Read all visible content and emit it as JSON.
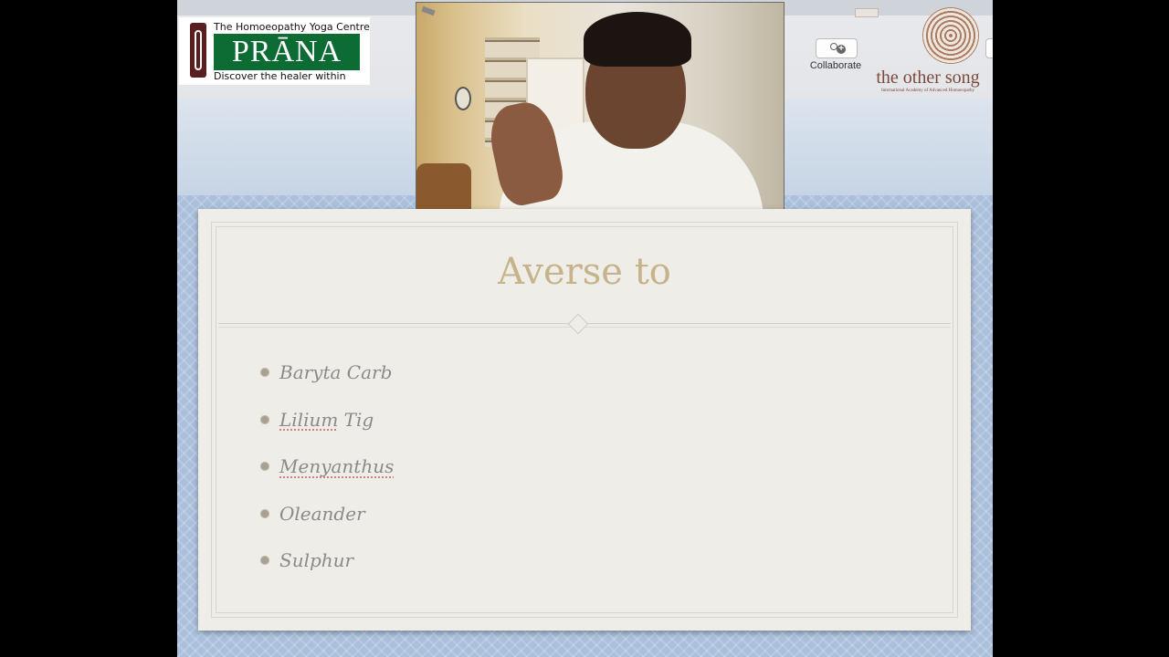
{
  "toolbar": {
    "logo_left": {
      "tagline": "The Homoeopathy Yoga Centre",
      "name": "PRĀNA",
      "subline": "Discover the healer within"
    },
    "collaborate_label": "Collaborate",
    "logo_right": {
      "name": "the other song",
      "subline": "International Academy of Advanced Homoeopathy"
    }
  },
  "video_call": {
    "participant_icon": "webcam-video-feed"
  },
  "slide": {
    "title": "Averse to",
    "bullets": [
      {
        "parts": [
          {
            "text": "Baryta Carb",
            "flagged": false
          }
        ]
      },
      {
        "parts": [
          {
            "text": "Lilium",
            "flagged": true
          },
          {
            "text": " Tig",
            "flagged": false
          }
        ]
      },
      {
        "parts": [
          {
            "text": "Menyanthus",
            "flagged": true
          }
        ]
      },
      {
        "parts": [
          {
            "text": "Oleander",
            "flagged": false
          }
        ]
      },
      {
        "parts": [
          {
            "text": "Sulphur",
            "flagged": false
          }
        ]
      }
    ]
  },
  "colors": {
    "title": "#c7b38a",
    "bullet_text": "#8a8a88",
    "prana_green": "#0d6b34",
    "prana_maroon": "#5a1e1e",
    "othersong_brown": "#7a4a3a",
    "stage_blue": "#a9bfdb"
  }
}
